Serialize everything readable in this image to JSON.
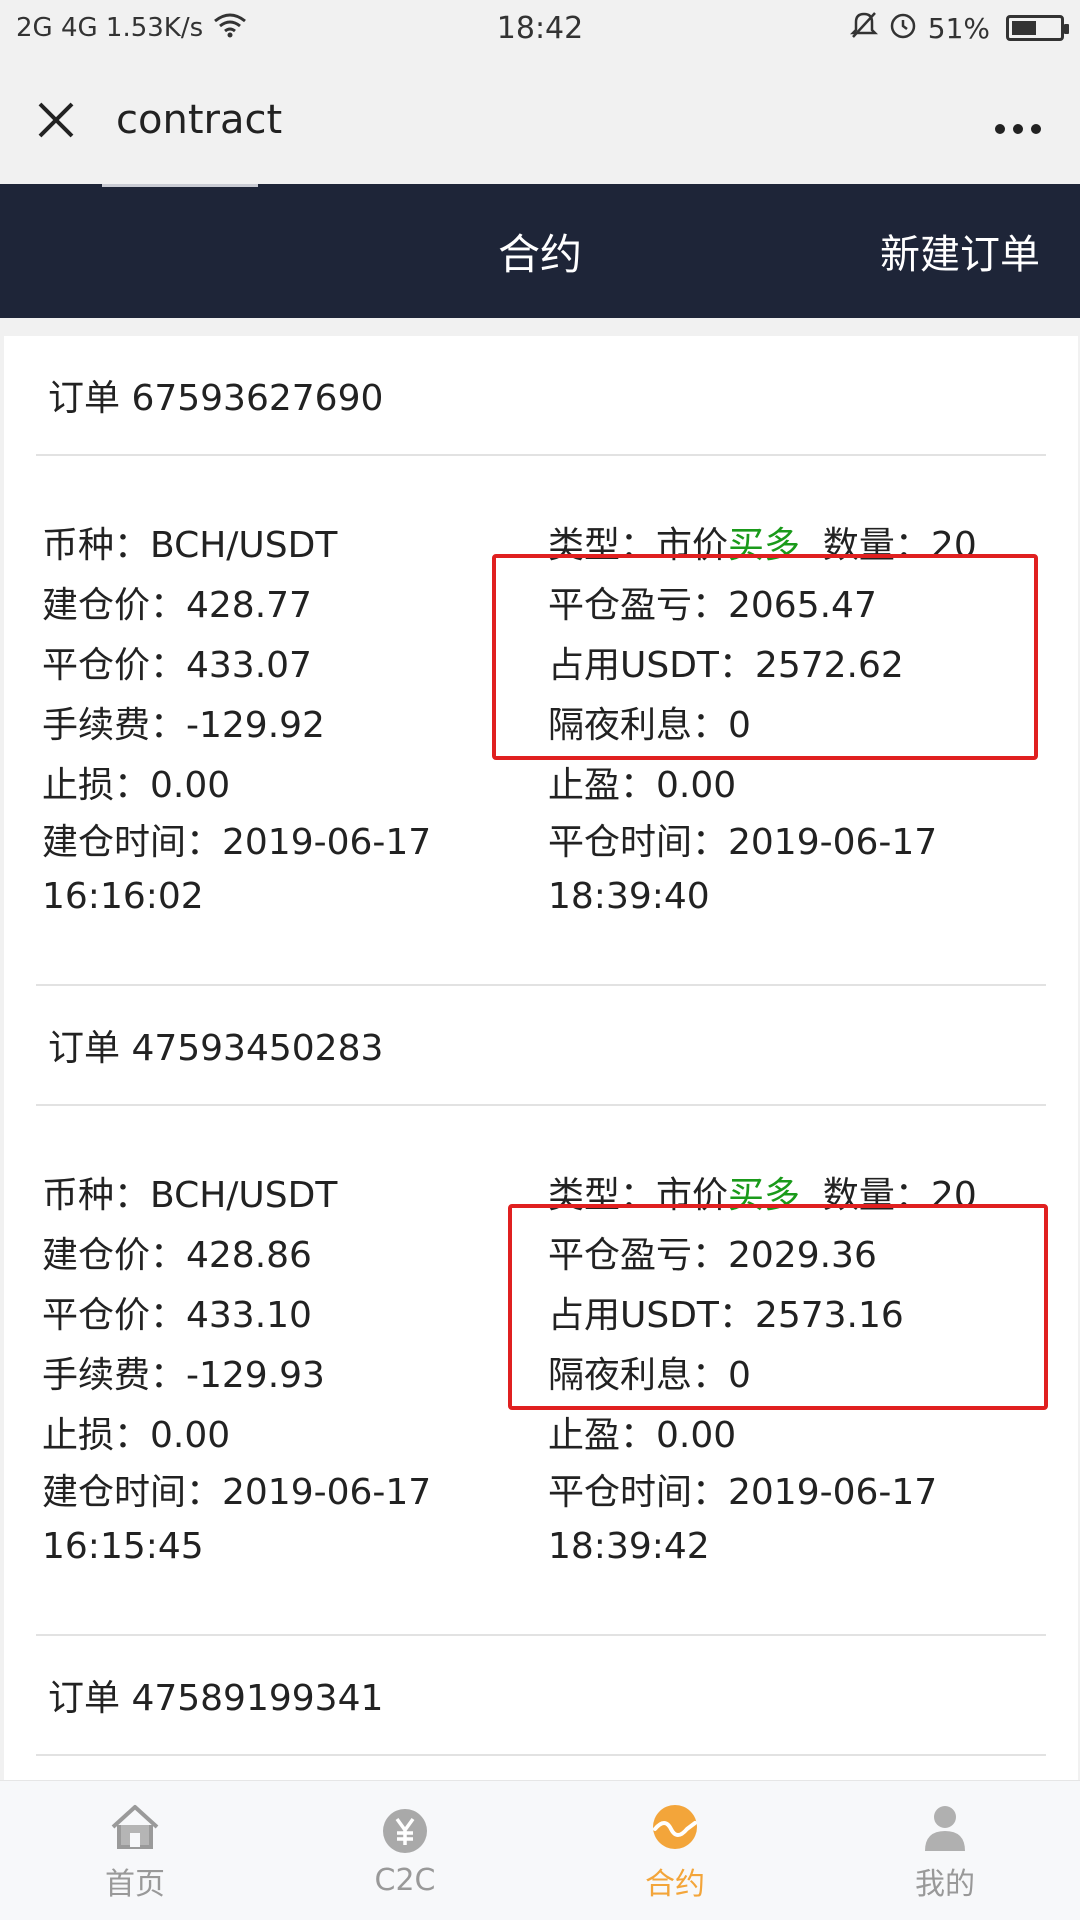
{
  "status": {
    "left": "2G 4G 1.53K/s",
    "time": "18:42",
    "battery": "51%"
  },
  "titlebar": {
    "title": "contract"
  },
  "header": {
    "title": "合约",
    "new_order": "新建订单"
  },
  "orders": [
    {
      "id": "订单 67593627690",
      "left": [
        "币种：BCH/USDT",
        "建仓价：428.77",
        "平仓价：433.07",
        "手续费：-129.92",
        "止损：0.00",
        "建仓时间：2019-06-17 16:16:02"
      ],
      "type_prefix": "类型：市价",
      "type_dir": "买多",
      "qty": "数量：20",
      "right": [
        "平仓盈亏：2065.47",
        "占用USDT：2572.62",
        "隔夜利息：0",
        "止盈：0.00",
        "平仓时间：2019-06-17 18:39:40"
      ]
    },
    {
      "id": "订单 47593450283",
      "left": [
        "币种：BCH/USDT",
        "建仓价：428.86",
        "平仓价：433.10",
        "手续费：-129.93",
        "止损：0.00",
        "建仓时间：2019-06-17 16:15:45"
      ],
      "type_prefix": "类型：市价",
      "type_dir": "买多",
      "qty": "数量：20",
      "right": [
        "平仓盈亏：2029.36",
        "占用USDT：2573.16",
        "隔夜利息：0",
        "止盈：0.00",
        "平仓时间：2019-06-17 18:39:42"
      ]
    },
    {
      "id": "订单 47589199341"
    }
  ],
  "nav": [
    {
      "label": "首页",
      "icon": "home-icon"
    },
    {
      "label": "C2C",
      "icon": "c2c-icon"
    },
    {
      "label": "合约",
      "icon": "contract-icon"
    },
    {
      "label": "我的",
      "icon": "profile-icon"
    }
  ],
  "colors": {
    "header_bg": "#1e2538",
    "active": "#f3a53a",
    "highlight": "#e02020",
    "long": "#1a9a1a"
  }
}
